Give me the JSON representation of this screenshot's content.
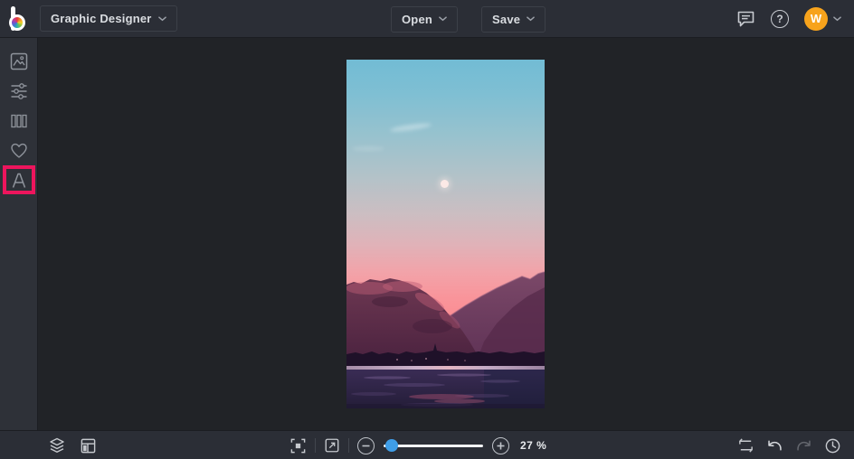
{
  "topbar": {
    "app_menu_label": "Graphic Designer",
    "open_label": "Open",
    "save_label": "Save",
    "help_glyph": "?",
    "avatar_initial": "W"
  },
  "sidebar": {
    "tools": [
      {
        "id": "image-manager",
        "icon": "image-icon"
      },
      {
        "id": "edit-adjust",
        "icon": "sliders-icon"
      },
      {
        "id": "layouts",
        "icon": "columns-icon"
      },
      {
        "id": "graphics",
        "icon": "heart-icon"
      },
      {
        "id": "text",
        "icon": "text-a-icon",
        "highlighted": true
      }
    ],
    "highlight_box_color": "#ED155D"
  },
  "canvas": {
    "description": "portrait sunset photo: blue-to-pink gradient sky with moon, purple mountain ridges, dark treeline and lake with reflections",
    "palette": {
      "sky_top": "#72BCD4",
      "sky_pink": "#FB8D93",
      "moon": "#FCE9E6",
      "mountain_far": "#7B4868",
      "mountain_near": "#5E2B47",
      "foliage_highlight": "#C06078",
      "treeline": "#1F1129",
      "shore_band": "#CDB2CB",
      "water": "#2B2240"
    }
  },
  "bottombar": {
    "zoom_label": "27 %",
    "icons_left": [
      "layers-icon",
      "layout-panel-icon"
    ],
    "icons_center": [
      "fit-screen-icon",
      "open-new-icon",
      "zoom-out-icon",
      "zoom-slider",
      "zoom-in-icon"
    ],
    "icons_right": [
      "repeat-icon",
      "undo-icon",
      "redo-icon",
      "history-icon"
    ],
    "redo_disabled": true
  },
  "colors": {
    "topbar_bg": "#2B2E36",
    "sidebar_bg": "#2E3138",
    "workspace_bg": "#212327",
    "accent_highlight": "#ED155D",
    "avatar_orange": "#F7A31C",
    "slider_knob_blue": "#3F9EE8"
  }
}
